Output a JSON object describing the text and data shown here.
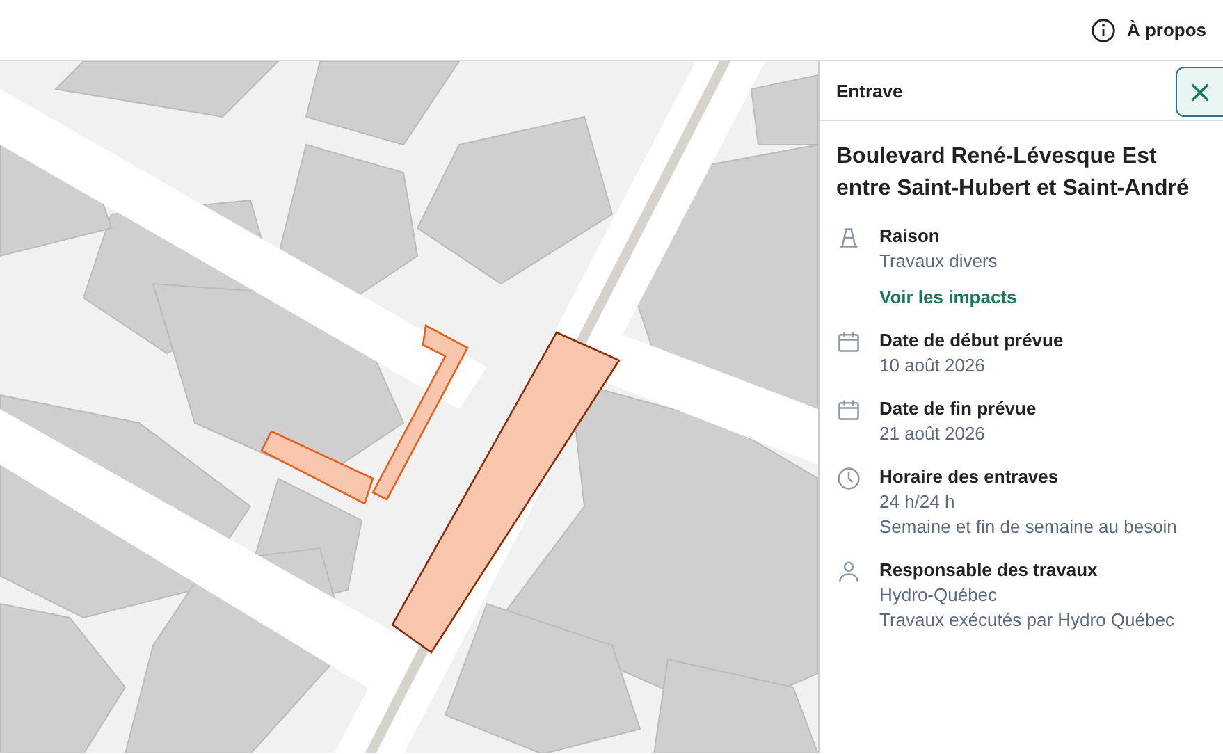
{
  "header": {
    "about_link": "À propos"
  },
  "panel": {
    "title": "Entrave",
    "heading": "Boulevard René-Lévesque Est\nentre Saint-Hubert et Saint-André",
    "sections": [
      {
        "kind": "cone",
        "label": "Raison",
        "lines": [
          "Travaux divers"
        ],
        "link": "Voir les impacts"
      },
      {
        "kind": "calendar",
        "label": "Date de début prévue",
        "lines": [
          "10 août 2026"
        ]
      },
      {
        "kind": "calendar",
        "label": "Date de fin prévue",
        "lines": [
          "21 août 2026"
        ]
      },
      {
        "kind": "clock",
        "label": "Horaire des entraves",
        "lines": [
          "24 h/24 h",
          "Semaine et fin de semaine au besoin"
        ]
      },
      {
        "kind": "person",
        "label": "Responsable des travaux",
        "lines": [
          "Hydro-Québec",
          "Travaux exécutés par Hydro Québec"
        ]
      }
    ]
  }
}
